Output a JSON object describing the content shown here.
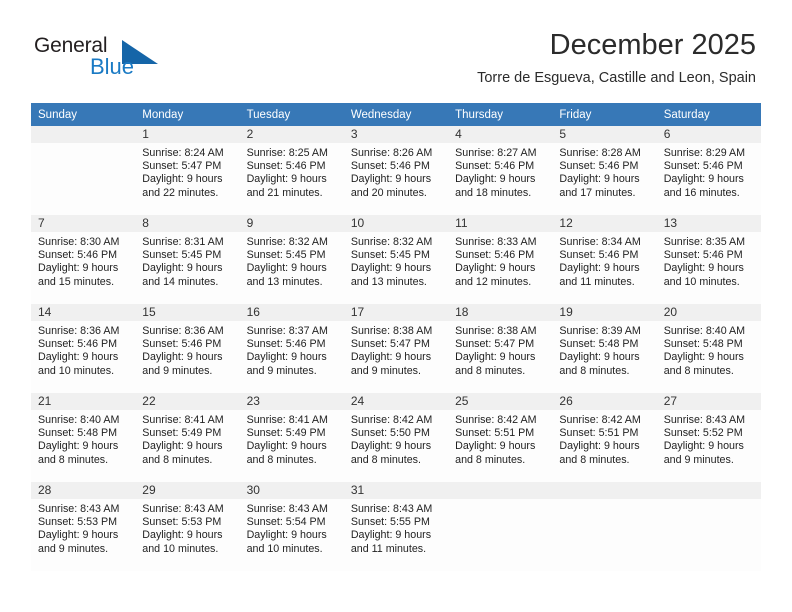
{
  "brand": {
    "name_part1": "General",
    "name_part2": "Blue",
    "logo_icon": "blue-triangle-icon",
    "color_dark": "#231f20",
    "color_blue": "#1a7ac4",
    "color_triangle": "#1565a8"
  },
  "header": {
    "month_title": "December 2025",
    "location": "Torre de Esgueva, Castille and Leon, Spain"
  },
  "calendar": {
    "header_background": "#3778b7",
    "daynum_background": "#f0f0f0",
    "weekdays": [
      "Sunday",
      "Monday",
      "Tuesday",
      "Wednesday",
      "Thursday",
      "Friday",
      "Saturday"
    ],
    "weeks": [
      [
        {
          "day": "",
          "sunrise": "",
          "sunset": "",
          "daylight1": "",
          "daylight2": ""
        },
        {
          "day": "1",
          "sunrise": "Sunrise: 8:24 AM",
          "sunset": "Sunset: 5:47 PM",
          "daylight1": "Daylight: 9 hours",
          "daylight2": "and 22 minutes."
        },
        {
          "day": "2",
          "sunrise": "Sunrise: 8:25 AM",
          "sunset": "Sunset: 5:46 PM",
          "daylight1": "Daylight: 9 hours",
          "daylight2": "and 21 minutes."
        },
        {
          "day": "3",
          "sunrise": "Sunrise: 8:26 AM",
          "sunset": "Sunset: 5:46 PM",
          "daylight1": "Daylight: 9 hours",
          "daylight2": "and 20 minutes."
        },
        {
          "day": "4",
          "sunrise": "Sunrise: 8:27 AM",
          "sunset": "Sunset: 5:46 PM",
          "daylight1": "Daylight: 9 hours",
          "daylight2": "and 18 minutes."
        },
        {
          "day": "5",
          "sunrise": "Sunrise: 8:28 AM",
          "sunset": "Sunset: 5:46 PM",
          "daylight1": "Daylight: 9 hours",
          "daylight2": "and 17 minutes."
        },
        {
          "day": "6",
          "sunrise": "Sunrise: 8:29 AM",
          "sunset": "Sunset: 5:46 PM",
          "daylight1": "Daylight: 9 hours",
          "daylight2": "and 16 minutes."
        }
      ],
      [
        {
          "day": "7",
          "sunrise": "Sunrise: 8:30 AM",
          "sunset": "Sunset: 5:46 PM",
          "daylight1": "Daylight: 9 hours",
          "daylight2": "and 15 minutes."
        },
        {
          "day": "8",
          "sunrise": "Sunrise: 8:31 AM",
          "sunset": "Sunset: 5:45 PM",
          "daylight1": "Daylight: 9 hours",
          "daylight2": "and 14 minutes."
        },
        {
          "day": "9",
          "sunrise": "Sunrise: 8:32 AM",
          "sunset": "Sunset: 5:45 PM",
          "daylight1": "Daylight: 9 hours",
          "daylight2": "and 13 minutes."
        },
        {
          "day": "10",
          "sunrise": "Sunrise: 8:32 AM",
          "sunset": "Sunset: 5:45 PM",
          "daylight1": "Daylight: 9 hours",
          "daylight2": "and 13 minutes."
        },
        {
          "day": "11",
          "sunrise": "Sunrise: 8:33 AM",
          "sunset": "Sunset: 5:46 PM",
          "daylight1": "Daylight: 9 hours",
          "daylight2": "and 12 minutes."
        },
        {
          "day": "12",
          "sunrise": "Sunrise: 8:34 AM",
          "sunset": "Sunset: 5:46 PM",
          "daylight1": "Daylight: 9 hours",
          "daylight2": "and 11 minutes."
        },
        {
          "day": "13",
          "sunrise": "Sunrise: 8:35 AM",
          "sunset": "Sunset: 5:46 PM",
          "daylight1": "Daylight: 9 hours",
          "daylight2": "and 10 minutes."
        }
      ],
      [
        {
          "day": "14",
          "sunrise": "Sunrise: 8:36 AM",
          "sunset": "Sunset: 5:46 PM",
          "daylight1": "Daylight: 9 hours",
          "daylight2": "and 10 minutes."
        },
        {
          "day": "15",
          "sunrise": "Sunrise: 8:36 AM",
          "sunset": "Sunset: 5:46 PM",
          "daylight1": "Daylight: 9 hours",
          "daylight2": "and 9 minutes."
        },
        {
          "day": "16",
          "sunrise": "Sunrise: 8:37 AM",
          "sunset": "Sunset: 5:46 PM",
          "daylight1": "Daylight: 9 hours",
          "daylight2": "and 9 minutes."
        },
        {
          "day": "17",
          "sunrise": "Sunrise: 8:38 AM",
          "sunset": "Sunset: 5:47 PM",
          "daylight1": "Daylight: 9 hours",
          "daylight2": "and 9 minutes."
        },
        {
          "day": "18",
          "sunrise": "Sunrise: 8:38 AM",
          "sunset": "Sunset: 5:47 PM",
          "daylight1": "Daylight: 9 hours",
          "daylight2": "and 8 minutes."
        },
        {
          "day": "19",
          "sunrise": "Sunrise: 8:39 AM",
          "sunset": "Sunset: 5:48 PM",
          "daylight1": "Daylight: 9 hours",
          "daylight2": "and 8 minutes."
        },
        {
          "day": "20",
          "sunrise": "Sunrise: 8:40 AM",
          "sunset": "Sunset: 5:48 PM",
          "daylight1": "Daylight: 9 hours",
          "daylight2": "and 8 minutes."
        }
      ],
      [
        {
          "day": "21",
          "sunrise": "Sunrise: 8:40 AM",
          "sunset": "Sunset: 5:48 PM",
          "daylight1": "Daylight: 9 hours",
          "daylight2": "and 8 minutes."
        },
        {
          "day": "22",
          "sunrise": "Sunrise: 8:41 AM",
          "sunset": "Sunset: 5:49 PM",
          "daylight1": "Daylight: 9 hours",
          "daylight2": "and 8 minutes."
        },
        {
          "day": "23",
          "sunrise": "Sunrise: 8:41 AM",
          "sunset": "Sunset: 5:49 PM",
          "daylight1": "Daylight: 9 hours",
          "daylight2": "and 8 minutes."
        },
        {
          "day": "24",
          "sunrise": "Sunrise: 8:42 AM",
          "sunset": "Sunset: 5:50 PM",
          "daylight1": "Daylight: 9 hours",
          "daylight2": "and 8 minutes."
        },
        {
          "day": "25",
          "sunrise": "Sunrise: 8:42 AM",
          "sunset": "Sunset: 5:51 PM",
          "daylight1": "Daylight: 9 hours",
          "daylight2": "and 8 minutes."
        },
        {
          "day": "26",
          "sunrise": "Sunrise: 8:42 AM",
          "sunset": "Sunset: 5:51 PM",
          "daylight1": "Daylight: 9 hours",
          "daylight2": "and 8 minutes."
        },
        {
          "day": "27",
          "sunrise": "Sunrise: 8:43 AM",
          "sunset": "Sunset: 5:52 PM",
          "daylight1": "Daylight: 9 hours",
          "daylight2": "and 9 minutes."
        }
      ],
      [
        {
          "day": "28",
          "sunrise": "Sunrise: 8:43 AM",
          "sunset": "Sunset: 5:53 PM",
          "daylight1": "Daylight: 9 hours",
          "daylight2": "and 9 minutes."
        },
        {
          "day": "29",
          "sunrise": "Sunrise: 8:43 AM",
          "sunset": "Sunset: 5:53 PM",
          "daylight1": "Daylight: 9 hours",
          "daylight2": "and 10 minutes."
        },
        {
          "day": "30",
          "sunrise": "Sunrise: 8:43 AM",
          "sunset": "Sunset: 5:54 PM",
          "daylight1": "Daylight: 9 hours",
          "daylight2": "and 10 minutes."
        },
        {
          "day": "31",
          "sunrise": "Sunrise: 8:43 AM",
          "sunset": "Sunset: 5:55 PM",
          "daylight1": "Daylight: 9 hours",
          "daylight2": "and 11 minutes."
        },
        {
          "day": "",
          "sunrise": "",
          "sunset": "",
          "daylight1": "",
          "daylight2": ""
        },
        {
          "day": "",
          "sunrise": "",
          "sunset": "",
          "daylight1": "",
          "daylight2": ""
        },
        {
          "day": "",
          "sunrise": "",
          "sunset": "",
          "daylight1": "",
          "daylight2": ""
        }
      ]
    ]
  }
}
